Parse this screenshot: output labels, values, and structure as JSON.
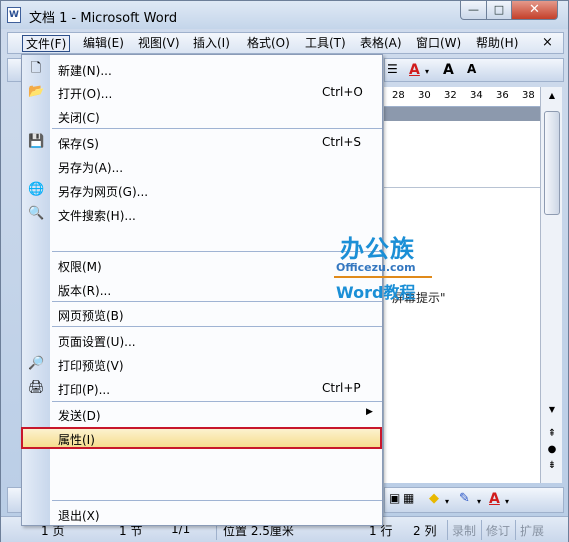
{
  "window": {
    "title": "文档 1 - Microsoft Word",
    "app_icon_letter": "W",
    "min_glyph": "—",
    "max_glyph": "□",
    "close_glyph": "✕"
  },
  "menubar": {
    "items": [
      "文件(F)",
      "编辑(E)",
      "视图(V)",
      "插入(I)",
      "格式(O)",
      "工具(T)",
      "表格(A)",
      "窗口(W)",
      "帮助(H)"
    ],
    "close_doc_glyph": "×"
  },
  "file_menu": {
    "items": [
      {
        "label": "新建(N)...",
        "icon": "new-document-icon",
        "glyph": "🗋",
        "shortcut": ""
      },
      {
        "label": "打开(O)...",
        "icon": "open-folder-icon",
        "glyph": "📂",
        "shortcut": "Ctrl+O"
      },
      {
        "label": "关闭(C)",
        "icon": "",
        "glyph": "",
        "shortcut": ""
      },
      {
        "label": "保存(S)",
        "icon": "save-icon",
        "glyph": "💾",
        "shortcut": "Ctrl+S"
      },
      {
        "label": "另存为(A)...",
        "icon": "",
        "glyph": "",
        "shortcut": ""
      },
      {
        "label": "另存为网页(G)...",
        "icon": "save-as-web-icon",
        "glyph": "🌐",
        "shortcut": ""
      },
      {
        "label": "文件搜索(H)...",
        "icon": "file-search-icon",
        "glyph": "🔍",
        "shortcut": ""
      },
      {
        "label": "权限(M)",
        "icon": "",
        "glyph": "",
        "shortcut": ""
      },
      {
        "label": "版本(R)...",
        "icon": "",
        "glyph": "",
        "shortcut": ""
      },
      {
        "label": "网页预览(B)",
        "icon": "",
        "glyph": "",
        "shortcut": ""
      },
      {
        "label": "页面设置(U)...",
        "icon": "",
        "glyph": "",
        "shortcut": ""
      },
      {
        "label": "打印预览(V)",
        "icon": "print-preview-icon",
        "glyph": "🔎",
        "shortcut": ""
      },
      {
        "label": "打印(P)...",
        "icon": "print-icon",
        "glyph": "🖨",
        "shortcut": "Ctrl+P"
      },
      {
        "label": "发送(D)",
        "icon": "",
        "glyph": "",
        "shortcut": "",
        "submenu_glyph": "▶"
      },
      {
        "label": "属性(I)",
        "icon": "",
        "glyph": "",
        "shortcut": ""
      },
      {
        "label": "退出(X)",
        "icon": "",
        "glyph": "",
        "shortcut": ""
      }
    ]
  },
  "ruler": {
    "numbers": [
      "28",
      "30",
      "32",
      "34",
      "36",
      "38"
    ]
  },
  "watermark": {
    "main": "办公族",
    "domain": "Officezu.com",
    "sub": "Word教程"
  },
  "document": {
    "visible_text": "屏幕提示\""
  },
  "toolbar": {
    "font_color_glyph": "A",
    "grow_font_glyph": "A",
    "shrink_font_glyph": "A"
  },
  "statusbar": {
    "page": "1 页",
    "section": "1 节",
    "pages": "1/1",
    "position": "位置 2.5厘米",
    "line": "1 行",
    "column": "2 列",
    "rec": "录制",
    "trk": "修订",
    "ext": "扩展"
  },
  "colors": {
    "highlight_border": "#c8172b",
    "accent_blue": "#1b8fd6",
    "font_color_red": "#d11c1c"
  }
}
